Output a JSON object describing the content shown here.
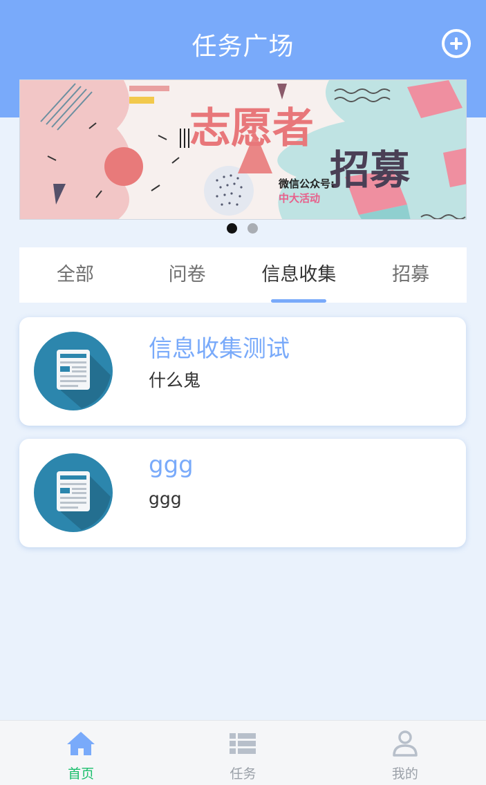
{
  "header": {
    "title": "任务广场",
    "add_icon": "plus-circle-icon"
  },
  "banner": {
    "title_line1": "志愿者",
    "title_line2": "招募",
    "wechat_label": "微信公众号:",
    "wechat_name": "中大活动",
    "slide_count": 2,
    "active_slide": 1
  },
  "tabs": [
    {
      "label": "全部",
      "active": false
    },
    {
      "label": "问卷",
      "active": false
    },
    {
      "label": "信息收集",
      "active": true
    },
    {
      "label": "招募",
      "active": false
    }
  ],
  "tasks": [
    {
      "title": "信息收集测试",
      "description": "什么鬼",
      "icon": "document-icon"
    },
    {
      "title": "ggg",
      "description": "ggg",
      "icon": "document-icon"
    }
  ],
  "tabbar": [
    {
      "label": "首页",
      "icon": "home-icon",
      "active": true
    },
    {
      "label": "任务",
      "icon": "list-icon",
      "active": false
    },
    {
      "label": "我的",
      "icon": "user-icon",
      "active": false
    }
  ],
  "colors": {
    "primary": "#79aafa",
    "background": "#eaf2fc",
    "active_tabbar_label": "#19be6b",
    "inactive_tabbar": "#9aa0a8"
  }
}
